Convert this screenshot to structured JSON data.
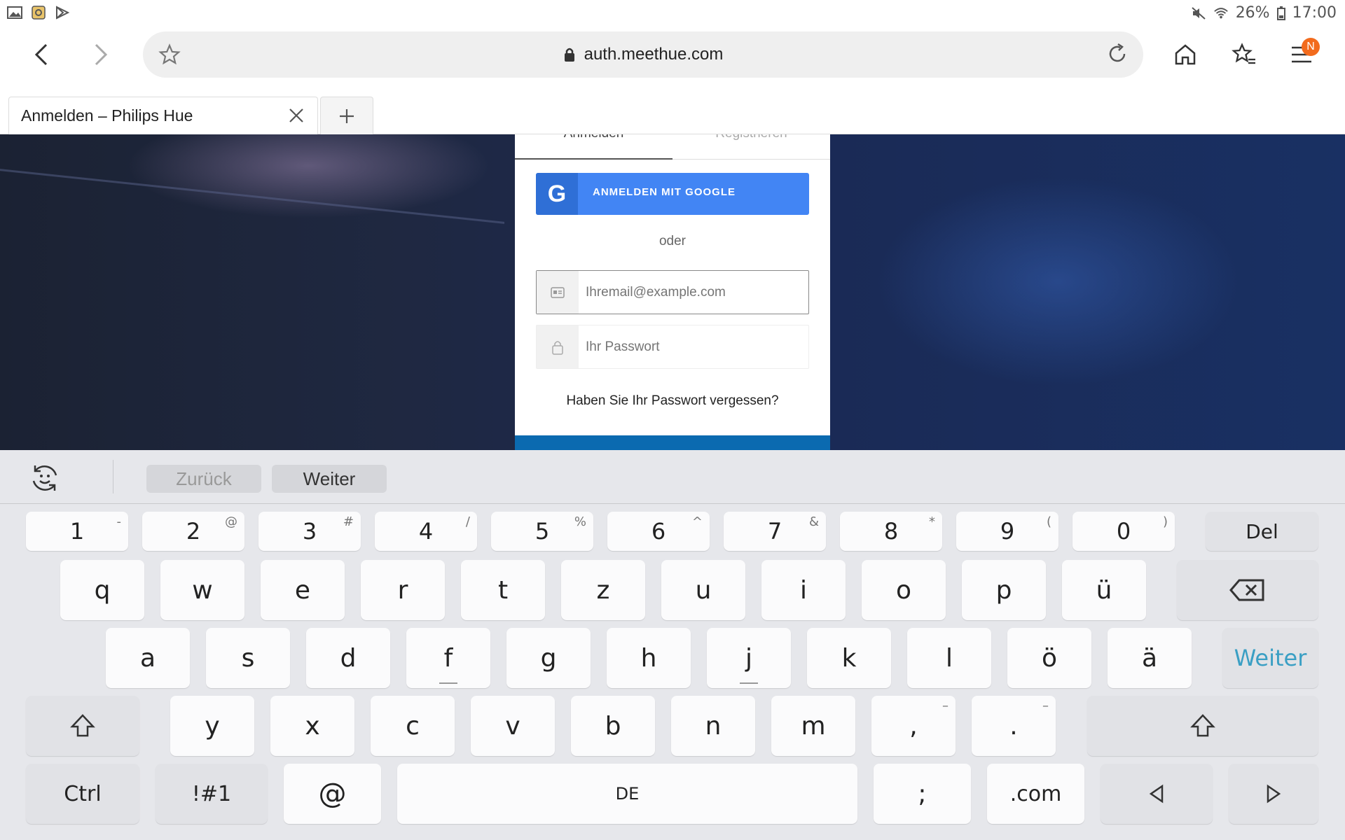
{
  "status_bar": {
    "battery": "26%",
    "time": "17:00"
  },
  "toolbar": {
    "url": "auth.meethue.com",
    "menu_badge": "N"
  },
  "tab": {
    "title": "Anmelden – Philips Hue"
  },
  "login": {
    "tab_signin": "Anmelden",
    "tab_register": "Registrieren",
    "google_button": "ANMELDEN MIT GOOGLE",
    "or_text": "oder",
    "email_placeholder": "Ihremail@example.com",
    "password_placeholder": "Ihr Passwort",
    "forgot_link": "Haben Sie Ihr Passwort vergessen?"
  },
  "keyboard": {
    "suggest_back": "Zurück",
    "suggest_next": "Weiter",
    "number_row": [
      {
        "main": "1",
        "sub": "-"
      },
      {
        "main": "2",
        "sub": "@"
      },
      {
        "main": "3",
        "sub": "#"
      },
      {
        "main": "4",
        "sub": "/"
      },
      {
        "main": "5",
        "sub": "%"
      },
      {
        "main": "6",
        "sub": "^"
      },
      {
        "main": "7",
        "sub": "&"
      },
      {
        "main": "8",
        "sub": "*"
      },
      {
        "main": "9",
        "sub": "("
      },
      {
        "main": "0",
        "sub": ")"
      }
    ],
    "del_label": "Del",
    "row1": [
      "q",
      "w",
      "e",
      "r",
      "t",
      "z",
      "u",
      "i",
      "o",
      "p",
      "ü"
    ],
    "row2": [
      "a",
      "s",
      "d",
      "f",
      "g",
      "h",
      "j",
      "k",
      "l",
      "ö",
      "ä"
    ],
    "row3": [
      "y",
      "x",
      "c",
      "v",
      "b",
      "n",
      "m"
    ],
    "comma_key": ",",
    "comma_sub": "–",
    "period_key": ".",
    "period_sub": "–",
    "enter_label": "Weiter",
    "ctrl_label": "Ctrl",
    "symbols_label": "!#1",
    "at_label": "@",
    "space_label": "DE",
    "semicolon_label": ";",
    "dotcom_label": ".com",
    "accent_color": "#3a9fc4"
  }
}
